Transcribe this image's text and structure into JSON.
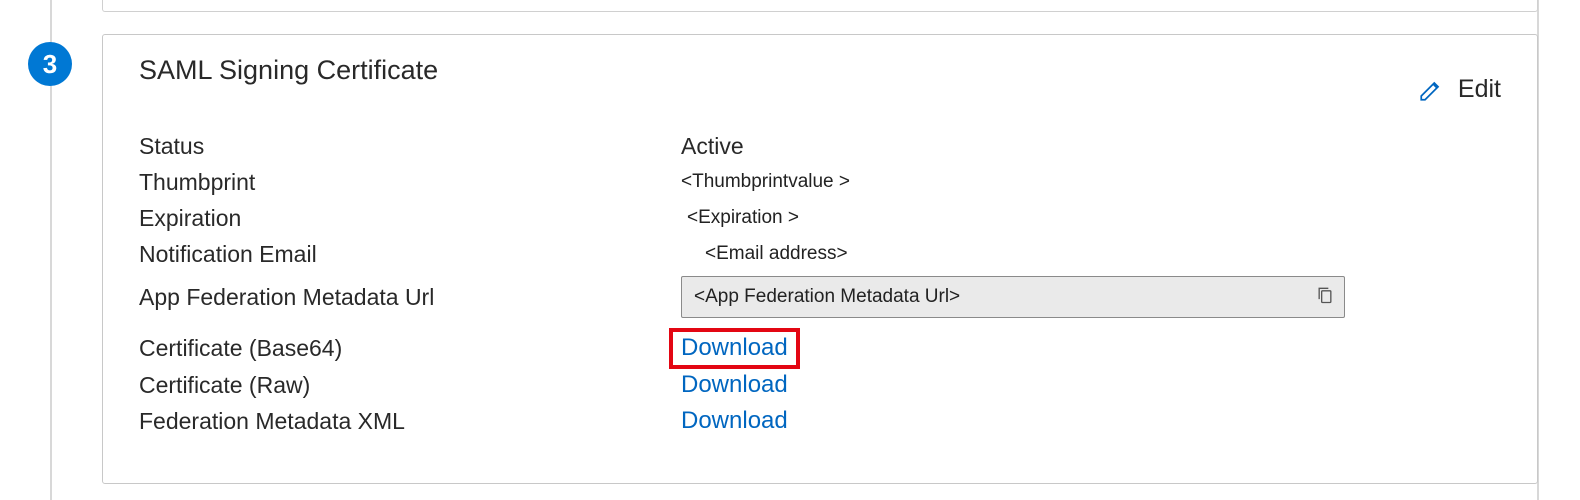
{
  "step_number": "3",
  "card": {
    "heading": "SAML Signing Certificate",
    "edit_label": "Edit",
    "fields": {
      "status": {
        "label": "Status",
        "value": "Active"
      },
      "thumbprint": {
        "label": "Thumbprint",
        "value": "<Thumbprintvalue >"
      },
      "expiration": {
        "label": "Expiration",
        "value": "<Expiration >"
      },
      "notification_email": {
        "label": "Notification Email",
        "value": "<Email address>"
      },
      "app_federation_metadata_url": {
        "label": "App Federation Metadata Url",
        "value": "<App Federation Metadata Url>"
      },
      "cert_base64": {
        "label": "Certificate (Base64)",
        "action": "Download"
      },
      "cert_raw": {
        "label": "Certificate (Raw)",
        "action": "Download"
      },
      "federation_metadata_xml": {
        "label": "Federation Metadata XML",
        "action": "Download"
      }
    }
  }
}
